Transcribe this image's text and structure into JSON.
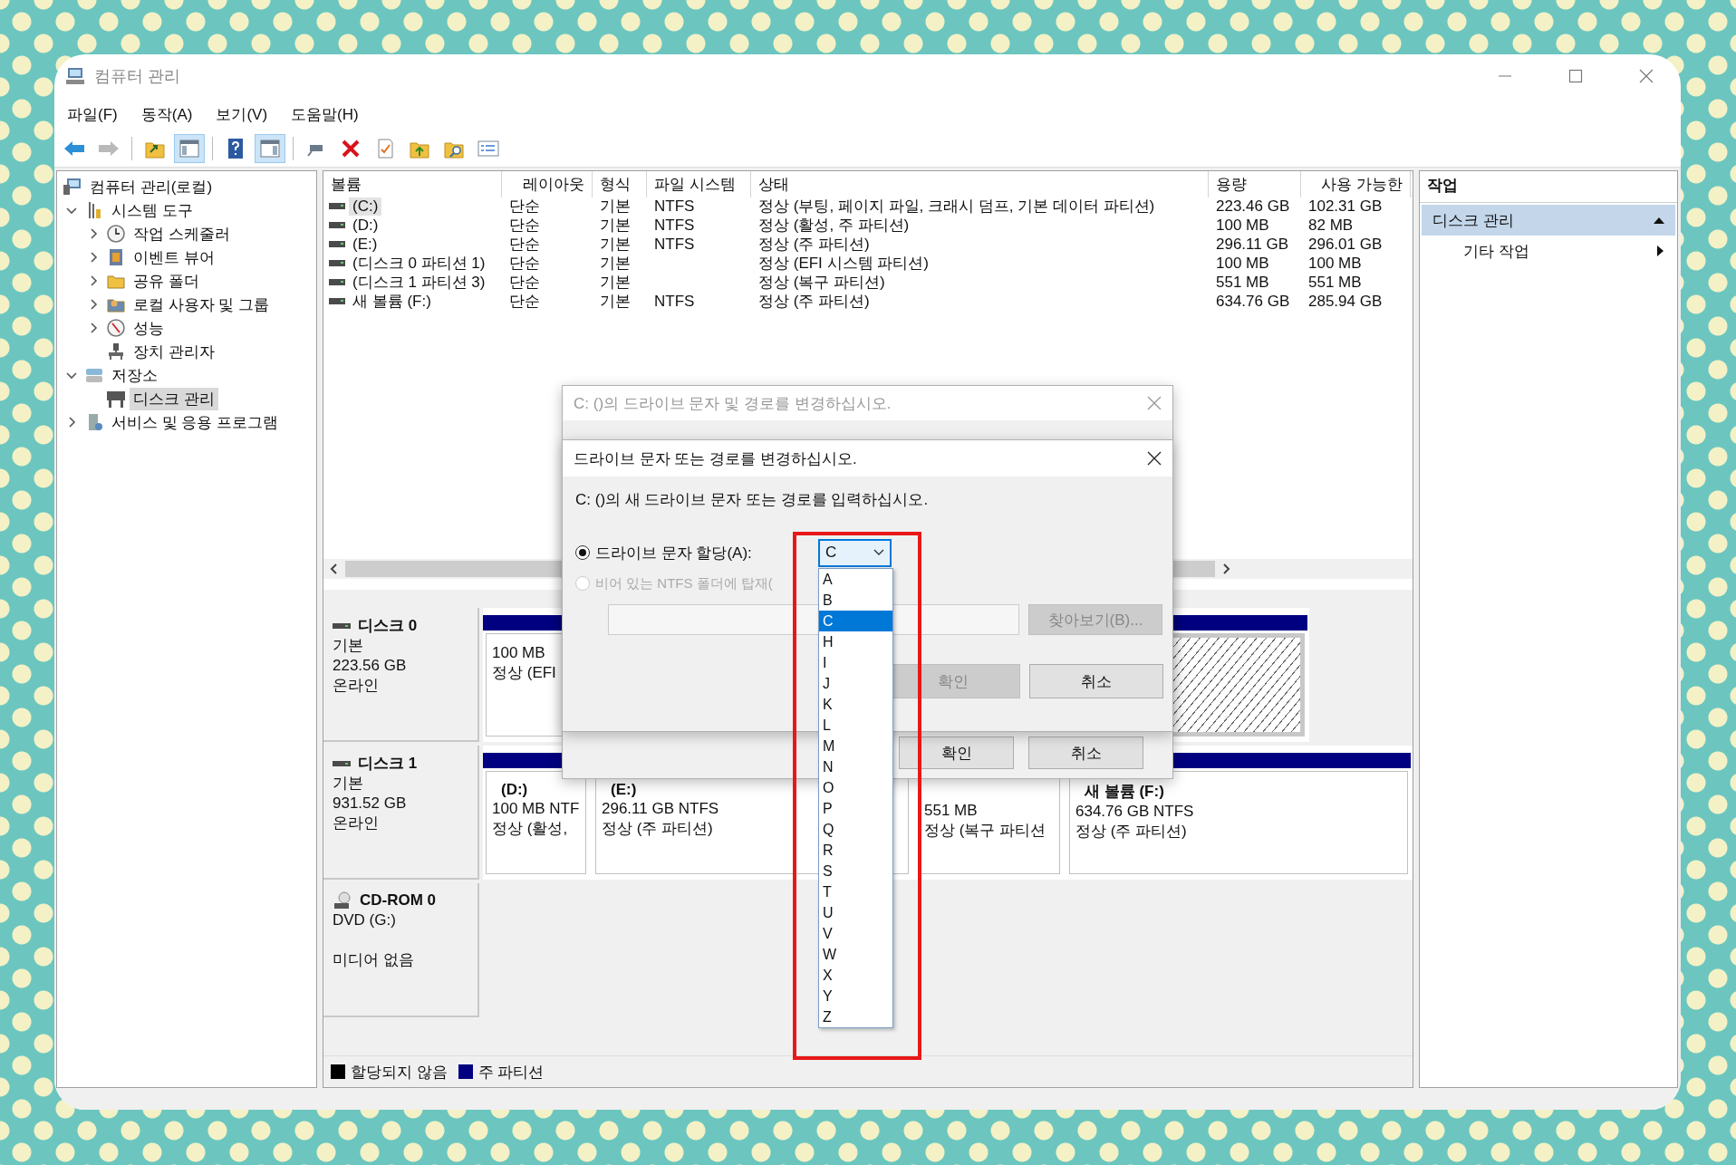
{
  "window": {
    "title": "컴퓨터 관리"
  },
  "menu": [
    "파일(F)",
    "동작(A)",
    "보기(V)",
    "도움말(H)"
  ],
  "toolbar": [
    {
      "kind": "back",
      "on": false,
      "disabled": false
    },
    {
      "kind": "forward",
      "on": false,
      "disabled": true
    },
    {
      "kind": "up",
      "on": false,
      "disabled": false
    },
    {
      "kind": "tree",
      "on": true,
      "disabled": false
    },
    {
      "kind": "help",
      "on": false,
      "disabled": false
    },
    {
      "kind": "pane",
      "on": true,
      "disabled": false
    },
    {
      "kind": "connect",
      "on": false,
      "disabled": false
    },
    {
      "kind": "delete",
      "on": false,
      "disabled": false
    },
    {
      "kind": "properties",
      "on": false,
      "disabled": false
    },
    {
      "kind": "folderup",
      "on": false,
      "disabled": false
    },
    {
      "kind": "search",
      "on": false,
      "disabled": false
    },
    {
      "kind": "list",
      "on": false,
      "disabled": false
    }
  ],
  "tree": [
    {
      "label": "컴퓨터 관리(로컬)",
      "kind": "computer",
      "selected": false,
      "children": [
        {
          "label": "시스템 도구",
          "kind": "tools",
          "expanded": true,
          "selected": false,
          "children": [
            {
              "label": "작업 스케줄러",
              "kind": "clock",
              "expanded": false,
              "selected": false
            },
            {
              "label": "이벤트 뷰어",
              "kind": "log",
              "expanded": false,
              "selected": false
            },
            {
              "label": "공유 폴더",
              "kind": "folder",
              "expanded": false,
              "selected": false
            },
            {
              "label": "로컬 사용자 및 그룹",
              "kind": "users",
              "expanded": false,
              "selected": false
            },
            {
              "label": "성능",
              "kind": "gauge",
              "expanded": false,
              "selected": false
            },
            {
              "label": "장치 관리자",
              "kind": "device",
              "selected": false
            }
          ]
        },
        {
          "label": "저장소",
          "kind": "storage",
          "expanded": true,
          "selected": false,
          "children": [
            {
              "label": "디스크 관리",
              "kind": "disk",
              "selected": true
            }
          ]
        },
        {
          "label": "서비스 및 응용 프로그램",
          "kind": "services",
          "expanded": false,
          "selected": false
        }
      ]
    }
  ],
  "table": {
    "columns": [
      "볼륨",
      "레이아웃",
      "형식",
      "파일 시스템",
      "상태",
      "용량",
      "사용 가능한"
    ],
    "rows": [
      {
        "selected": true,
        "cells": [
          "(C:)",
          "단순",
          "기본",
          "NTFS",
          "정상 (부팅, 페이지 파일, 크래시 덤프, 기본 데이터 파티션)",
          "223.46 GB",
          "102.31 GB"
        ]
      },
      {
        "selected": false,
        "cells": [
          "(D:)",
          "단순",
          "기본",
          "NTFS",
          "정상 (활성, 주 파티션)",
          "100 MB",
          "82 MB"
        ]
      },
      {
        "selected": false,
        "cells": [
          "(E:)",
          "단순",
          "기본",
          "NTFS",
          "정상 (주 파티션)",
          "296.11 GB",
          "296.01 GB"
        ]
      },
      {
        "selected": false,
        "cells": [
          "(디스크 0 파티션 1)",
          "단순",
          "기본",
          "",
          "정상 (EFI 시스템 파티션)",
          "100 MB",
          "100 MB"
        ]
      },
      {
        "selected": false,
        "cells": [
          "(디스크 1 파티션 3)",
          "단순",
          "기본",
          "",
          "정상 (복구 파티션)",
          "551 MB",
          "551 MB"
        ]
      },
      {
        "selected": false,
        "cells": [
          "새 볼륨 (F:)",
          "단순",
          "기본",
          "NTFS",
          "정상 (주 파티션)",
          "634.76 GB",
          "285.94 GB"
        ]
      }
    ]
  },
  "disks": [
    {
      "kind": "disk",
      "name": "디스크 0",
      "lines": [
        "기본",
        "223.56 GB",
        "온라인"
      ],
      "partitions": [
        {
          "lines": [
            "100 MB",
            "정상 (EFI"
          ],
          "selected": false
        },
        {
          "selected": true
        }
      ]
    },
    {
      "kind": "disk",
      "name": "디스크 1",
      "lines": [
        "기본",
        "931.52 GB",
        "온라인"
      ],
      "partitions": [
        {
          "title": "(D:)",
          "lines": [
            "100 MB NTF",
            "정상 (활성,"
          ],
          "selected": false
        },
        {
          "title": "(E:)",
          "lines": [
            "296.11 GB NTFS",
            "정상 (주 파티션)"
          ],
          "selected": false
        },
        {
          "lines": [
            "551 MB",
            "정상 (복구 파티션"
          ],
          "selected": false
        },
        {
          "title": "새 볼륨  (F:)",
          "lines": [
            "634.76 GB NTFS",
            "정상 (주 파티션)"
          ],
          "selected": false
        }
      ]
    },
    {
      "kind": "cdrom",
      "name": "CD-ROM 0",
      "lines": [
        "DVD (G:)",
        "미디어 없음"
      ]
    }
  ],
  "legend": [
    {
      "label": "할당되지 않음",
      "color": "#000000"
    },
    {
      "label": "주 파티션",
      "color": "#000080"
    }
  ],
  "actions": {
    "title": "작업",
    "section": "디스크 관리",
    "items": [
      "기타 작업"
    ]
  },
  "outer_dialog": {
    "title": "C: ()의 드라이브 문자 및 경로를 변경하십시오.",
    "buttons": [
      {
        "label": "확인",
        "disabled": false
      },
      {
        "label": "취소",
        "disabled": false
      }
    ]
  },
  "dialog": {
    "title": "드라이브 문자 또는 경로를 변경하십시오.",
    "prompt": "C: ()의 새 드라이브 문자 또는 경로를 입력하십시오.",
    "options": [
      {
        "label": "드라이브 문자 할당(A):",
        "selected": true,
        "disabled": false
      },
      {
        "label": "비어 있는 NTFS 폴더에 탑재(",
        "selected": false,
        "disabled": true
      }
    ],
    "drive_letter": {
      "value": "C",
      "expanded": true,
      "items": [
        {
          "label": "A",
          "selected": false
        },
        {
          "label": "B",
          "selected": false
        },
        {
          "label": "C",
          "selected": true
        },
        {
          "label": "H",
          "selected": false
        },
        {
          "label": "I",
          "selected": false
        },
        {
          "label": "J",
          "selected": false
        },
        {
          "label": "K",
          "selected": false
        },
        {
          "label": "L",
          "selected": false
        },
        {
          "label": "M",
          "selected": false
        },
        {
          "label": "N",
          "selected": false
        },
        {
          "label": "O",
          "selected": false
        },
        {
          "label": "P",
          "selected": false
        },
        {
          "label": "Q",
          "selected": false
        },
        {
          "label": "R",
          "selected": false
        },
        {
          "label": "S",
          "selected": false
        },
        {
          "label": "T",
          "selected": false
        },
        {
          "label": "U",
          "selected": false
        },
        {
          "label": "V",
          "selected": false
        },
        {
          "label": "W",
          "selected": false
        },
        {
          "label": "X",
          "selected": false
        },
        {
          "label": "Y",
          "selected": false
        },
        {
          "label": "Z",
          "selected": false
        }
      ]
    },
    "browse_button": {
      "label": "찾아보기(B)...",
      "disabled": true
    },
    "buttons": [
      {
        "label": "확인",
        "disabled": true
      },
      {
        "label": "취소",
        "disabled": false
      }
    ]
  }
}
